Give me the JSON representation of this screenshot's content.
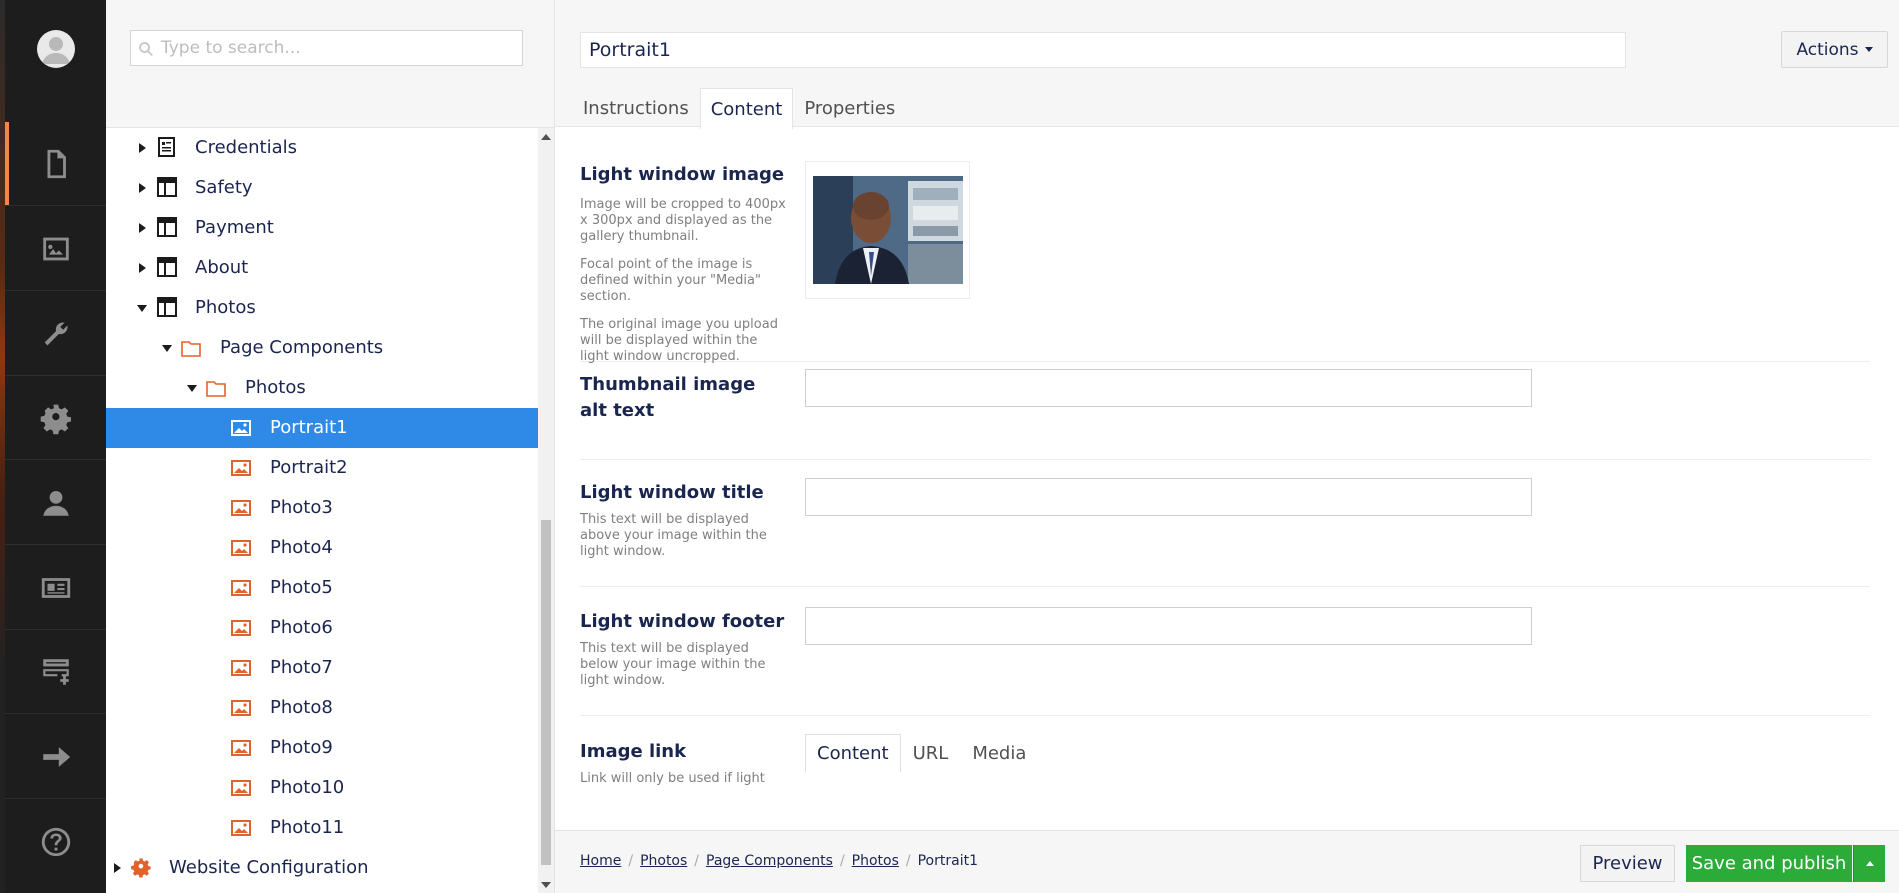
{
  "search": {
    "placeholder": "Type to search..."
  },
  "rail": {
    "items": [
      {
        "icon": "document-icon",
        "active": true
      },
      {
        "icon": "image-icon"
      },
      {
        "icon": "wrench-icon"
      },
      {
        "icon": "gear-icon"
      },
      {
        "icon": "user-icon"
      },
      {
        "icon": "id-card-icon"
      },
      {
        "icon": "forms-icon"
      },
      {
        "icon": "arrow-right-icon"
      },
      {
        "icon": "help-icon"
      }
    ]
  },
  "tree": {
    "nodes": [
      {
        "label": "Credentials",
        "icon": "doc-list-icon",
        "caret": "right"
      },
      {
        "label": "Safety",
        "icon": "layout-icon",
        "caret": "right"
      },
      {
        "label": "Payment",
        "icon": "layout-icon",
        "caret": "right"
      },
      {
        "label": "About",
        "icon": "layout-icon",
        "caret": "right"
      },
      {
        "label": "Photos",
        "icon": "layout-icon",
        "caret": "down"
      },
      {
        "label": "Page Components",
        "icon": "folder-icon",
        "caret": "down"
      },
      {
        "label": "Photos",
        "icon": "folder-icon",
        "caret": "down"
      },
      {
        "label": "Portrait1",
        "icon": "picture-icon",
        "selected": true
      },
      {
        "label": "Portrait2",
        "icon": "picture-icon"
      },
      {
        "label": "Photo3",
        "icon": "picture-icon"
      },
      {
        "label": "Photo4",
        "icon": "picture-icon"
      },
      {
        "label": "Photo5",
        "icon": "picture-icon"
      },
      {
        "label": "Photo6",
        "icon": "picture-icon"
      },
      {
        "label": "Photo7",
        "icon": "picture-icon"
      },
      {
        "label": "Photo8",
        "icon": "picture-icon"
      },
      {
        "label": "Photo9",
        "icon": "picture-icon"
      },
      {
        "label": "Photo10",
        "icon": "picture-icon"
      },
      {
        "label": "Photo11",
        "icon": "picture-icon"
      },
      {
        "label": "Website Configuration",
        "icon": "gear-orange-icon",
        "caret": "right"
      }
    ]
  },
  "editor": {
    "name_value": "Portrait1",
    "actions_label": "Actions",
    "tabs": [
      "Instructions",
      "Content",
      "Properties"
    ],
    "active_tab": "Content",
    "properties": {
      "light_window_image": {
        "label": "Light window image",
        "desc1": "Image will be cropped to 400px x 300px and displayed as the gallery thumbnail.",
        "desc2": "Focal point of the image is defined within your \"Media\" section.",
        "desc3": "The original image you upload will be displayed within the light window uncropped."
      },
      "thumb_alt": {
        "label": "Thumbnail image alt text",
        "value": ""
      },
      "lw_title": {
        "label": "Light window title",
        "desc": "This text will be displayed above your image within the light window.",
        "value": ""
      },
      "lw_footer": {
        "label": "Light window footer",
        "desc": "This text will be displayed below your image within the light window.",
        "value": ""
      },
      "image_link": {
        "label": "Image link",
        "desc": "Link will only be used if light",
        "tabs": [
          "Content",
          "URL",
          "Media"
        ]
      }
    }
  },
  "footer": {
    "breadcrumbs": [
      "Home",
      "Photos",
      "Page Components",
      "Photos"
    ],
    "current": "Portrait1",
    "preview_label": "Preview",
    "save_label": "Save and publish"
  },
  "colors": {
    "accent": "#f5844d",
    "selected": "#2e8ae6",
    "save": "#2bac38",
    "icon_orange": "#e0632b"
  }
}
